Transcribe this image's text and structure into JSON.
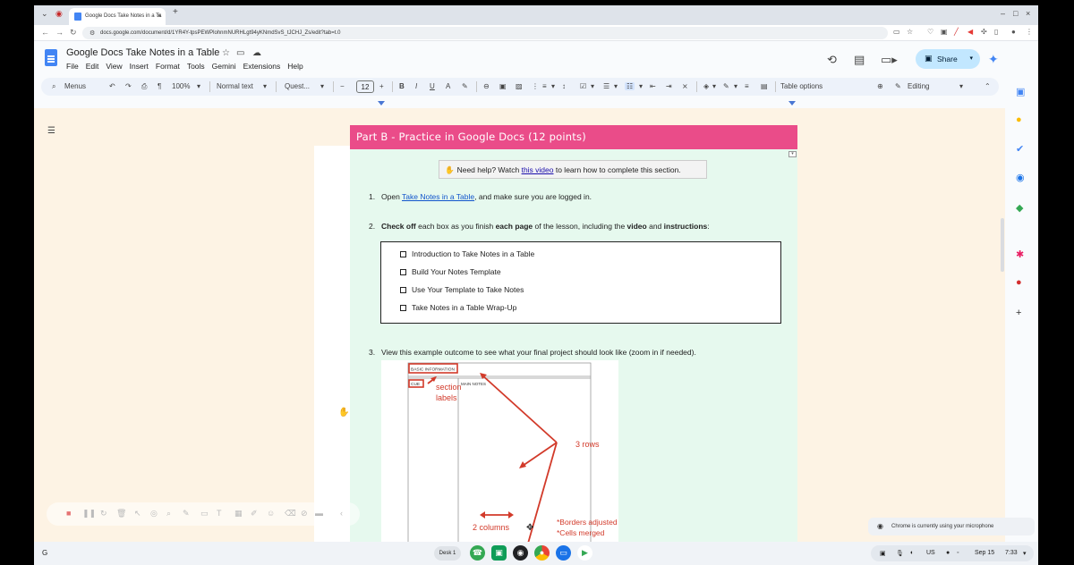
{
  "browser": {
    "tab_title": "Google Docs Take Notes in a Ta",
    "url": "docs.google.com/document/d/1YR4Y-tpsPEWPlohnmNURHLgt94yKNmdSvS_tJCHJ_Zs/edit?tab=t.0",
    "new_tab": "+",
    "tab_close": "×"
  },
  "docs": {
    "title": "Google Docs Take Notes in a Table",
    "menus": [
      "File",
      "Edit",
      "View",
      "Insert",
      "Format",
      "Tools",
      "Gemini",
      "Extensions",
      "Help"
    ],
    "share_label": "Share"
  },
  "toolbar": {
    "menus_label": "Menus",
    "zoom": "100%",
    "style": "Normal text",
    "font": "Quest...",
    "font_size": "12",
    "table_options": "Table options",
    "mode": "Editing"
  },
  "document": {
    "banner_title": "Part B - Practice in Google Docs (12 points)",
    "help": {
      "icon": "✋",
      "before": "Need help? Watch ",
      "link": "this video",
      "after": " to learn how to complete this section."
    },
    "item1": {
      "num": "1.",
      "before": "Open ",
      "link": "Take Notes in a Table",
      "after": ", and make sure you are logged in."
    },
    "item2": {
      "num": "2.",
      "p1": "Check off",
      "p2": " each box as you finish ",
      "p3": "each page",
      "p4": " of the lesson, including the ",
      "p5": "video",
      "p6": " and ",
      "p7": "instructions",
      "p8": ":"
    },
    "checklist": [
      "Introduction to Take Notes in a Table",
      "Build Your Notes Template",
      "Use Your Template to Take Notes",
      "Take Notes in a Table Wrap-Up"
    ],
    "item3": {
      "num": "3.",
      "text": "View this example outcome to see what your final project should look like (zoom in if needed)."
    },
    "example": {
      "basic_info": "BASIC INFORMATION",
      "cue": "CUE",
      "main_notes": "MAIN NOTES",
      "section_labels": [
        "section",
        "labels"
      ],
      "rows": "3 rows",
      "columns": "2 columns",
      "borders": [
        "*Borders adjusted",
        "*Cells merged"
      ]
    }
  },
  "system": {
    "desk": "Desk 1",
    "notification": "Chrome is currently using your microphone",
    "locale": "US",
    "date": "Sep 15",
    "time": "7:33"
  },
  "colors": {
    "banner": "#ea4c89",
    "content_bg": "#e6f9ee",
    "canvas_bg": "#fdf3e4",
    "annotation_red": "#d23a2a",
    "share_bg": "#c2e7ff"
  }
}
